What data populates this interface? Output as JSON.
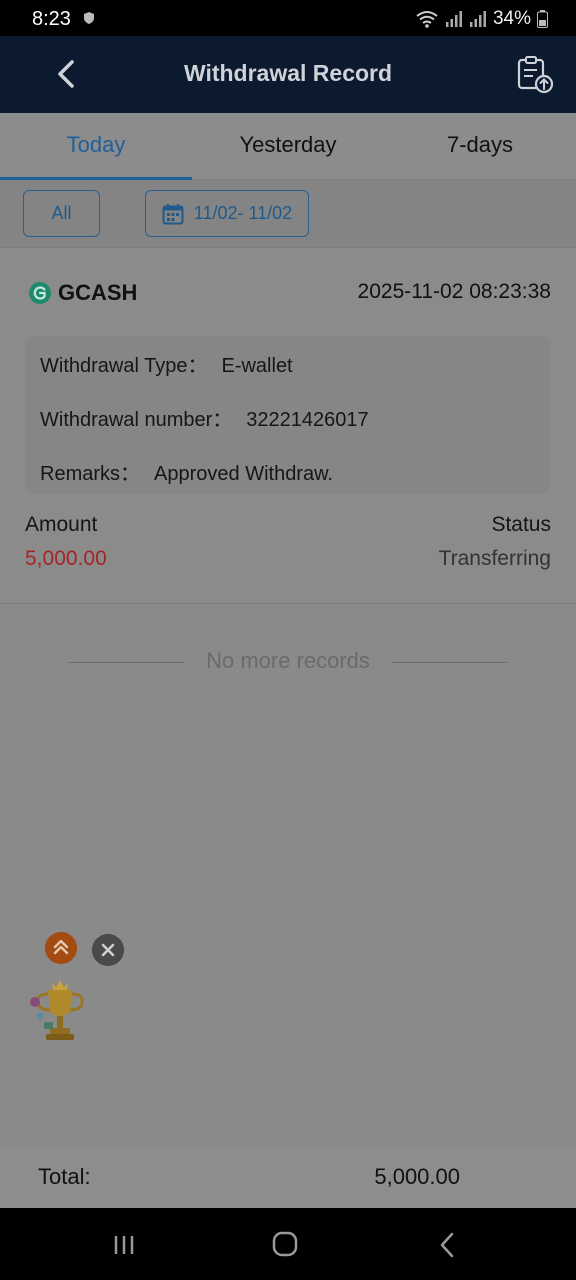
{
  "status_bar": {
    "time": "8:23",
    "battery": "34%"
  },
  "header": {
    "title": "Withdrawal Record"
  },
  "tabs": [
    {
      "label": "Today",
      "active": true
    },
    {
      "label": "Yesterday",
      "active": false
    },
    {
      "label": "7-days",
      "active": false
    }
  ],
  "filters": {
    "all_label": "All",
    "date_range": "11/02- 11/02"
  },
  "record": {
    "method": "GCASH",
    "datetime": "2025-11-02 08:23:38",
    "type_label": "Withdrawal Type：",
    "type_value": "E-wallet",
    "number_label": "Withdrawal number：",
    "number_value": "32221426017",
    "remarks_label": "Remarks：",
    "remarks_value": "Approved Withdraw.",
    "amount_label": "Amount",
    "amount_value": "5,000.00",
    "status_label": "Status",
    "status_value": "Transferring"
  },
  "list_end": "No more records",
  "footer": {
    "total_label": "Total:",
    "total_value": "5,000.00"
  },
  "colors": {
    "accent": "#1f5f9a",
    "amount": "#a52525",
    "header_bg": "#0b1a2e"
  }
}
